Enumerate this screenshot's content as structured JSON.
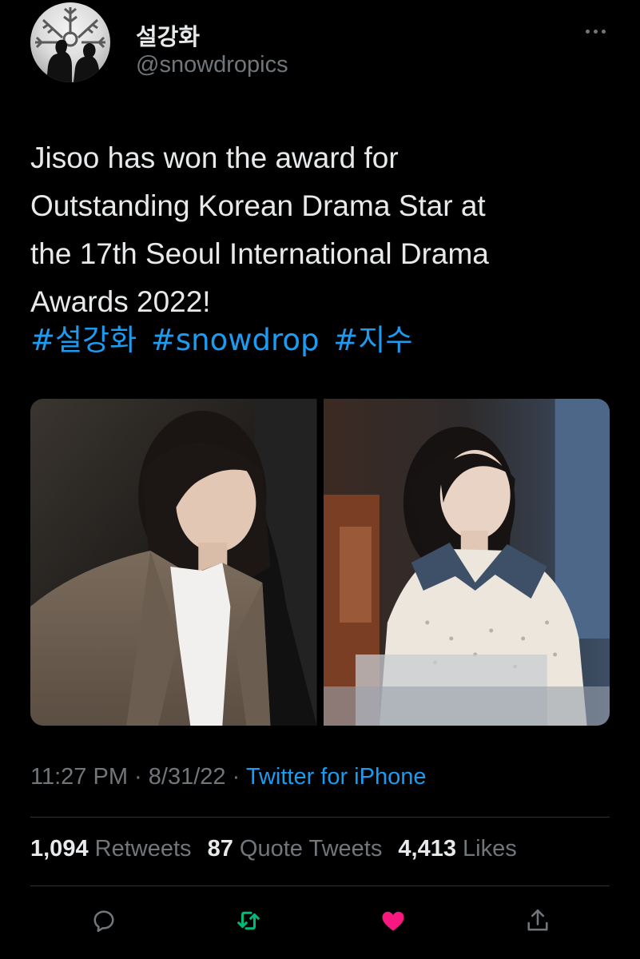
{
  "author": {
    "display_name": "설강화",
    "handle": "@snowdropics",
    "avatar_icon": "snowflake-couple-avatar"
  },
  "more_icon": "more-horizontal-icon",
  "tweet": {
    "lines": [
      "Jisoo has won the award for",
      "Outstanding Korean Drama Star at",
      "the 17th Seoul International Drama",
      "Awards 2022!"
    ],
    "hashtags": [
      "#설강화",
      "#snowdrop",
      "#지수"
    ]
  },
  "media": [
    {
      "name": "photo-jisoo-blazer"
    },
    {
      "name": "photo-jisoo-sweater"
    }
  ],
  "meta": {
    "time": "11:27 PM",
    "separator": "·",
    "date": "8/31/22",
    "source": "Twitter for iPhone"
  },
  "stats": {
    "retweets_count": "1,094",
    "retweets_label": "Retweets",
    "quotes_count": "87",
    "quotes_label": "Quote Tweets",
    "likes_count": "4,413",
    "likes_label": "Likes"
  },
  "actions": {
    "reply_icon": "reply-icon",
    "retweet_icon": "retweet-icon",
    "like_icon": "like-icon",
    "share_icon": "share-icon"
  },
  "colors": {
    "background": "#000000",
    "text": "#e7e9ea",
    "secondary": "#71767b",
    "accent": "#1d9bf0",
    "retweet_active": "#00ba7c",
    "like_active": "#f91880",
    "divider": "#2f3336"
  }
}
